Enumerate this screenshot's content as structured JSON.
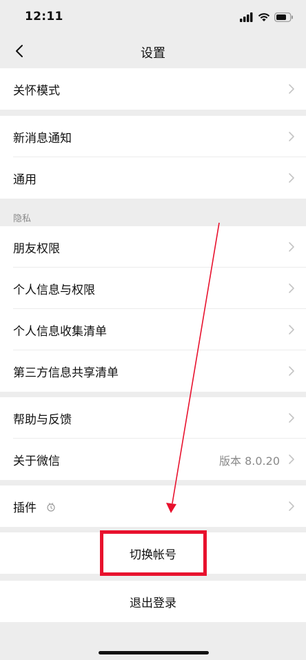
{
  "status_bar": {
    "time": "12:11"
  },
  "nav": {
    "title": "设置"
  },
  "rows": {
    "care_mode": "关怀模式",
    "new_message_notify": "新消息通知",
    "general": "通用",
    "privacy_header": "隐私",
    "friend_permissions": "朋友权限",
    "personal_info_permissions": "个人信息与权限",
    "personal_info_collection": "个人信息收集清单",
    "third_party_sharing": "第三方信息共享清单",
    "help_feedback": "帮助与反馈",
    "about_wechat": "关于微信",
    "about_version": "版本 8.0.20",
    "plugins": "插件"
  },
  "actions": {
    "switch_account": "切换帐号",
    "log_out": "退出登录"
  },
  "colors": {
    "background": "#ededed",
    "row_background": "#ffffff",
    "annotation_red": "#e8112d",
    "secondary_text": "#8a8a8a"
  },
  "icons": {
    "back": "chevron-left-icon",
    "disclosure": "chevron-right-icon",
    "plugin": "plugin-icon",
    "signal": "signal-icon",
    "wifi": "wifi-icon",
    "battery": "battery-icon"
  }
}
